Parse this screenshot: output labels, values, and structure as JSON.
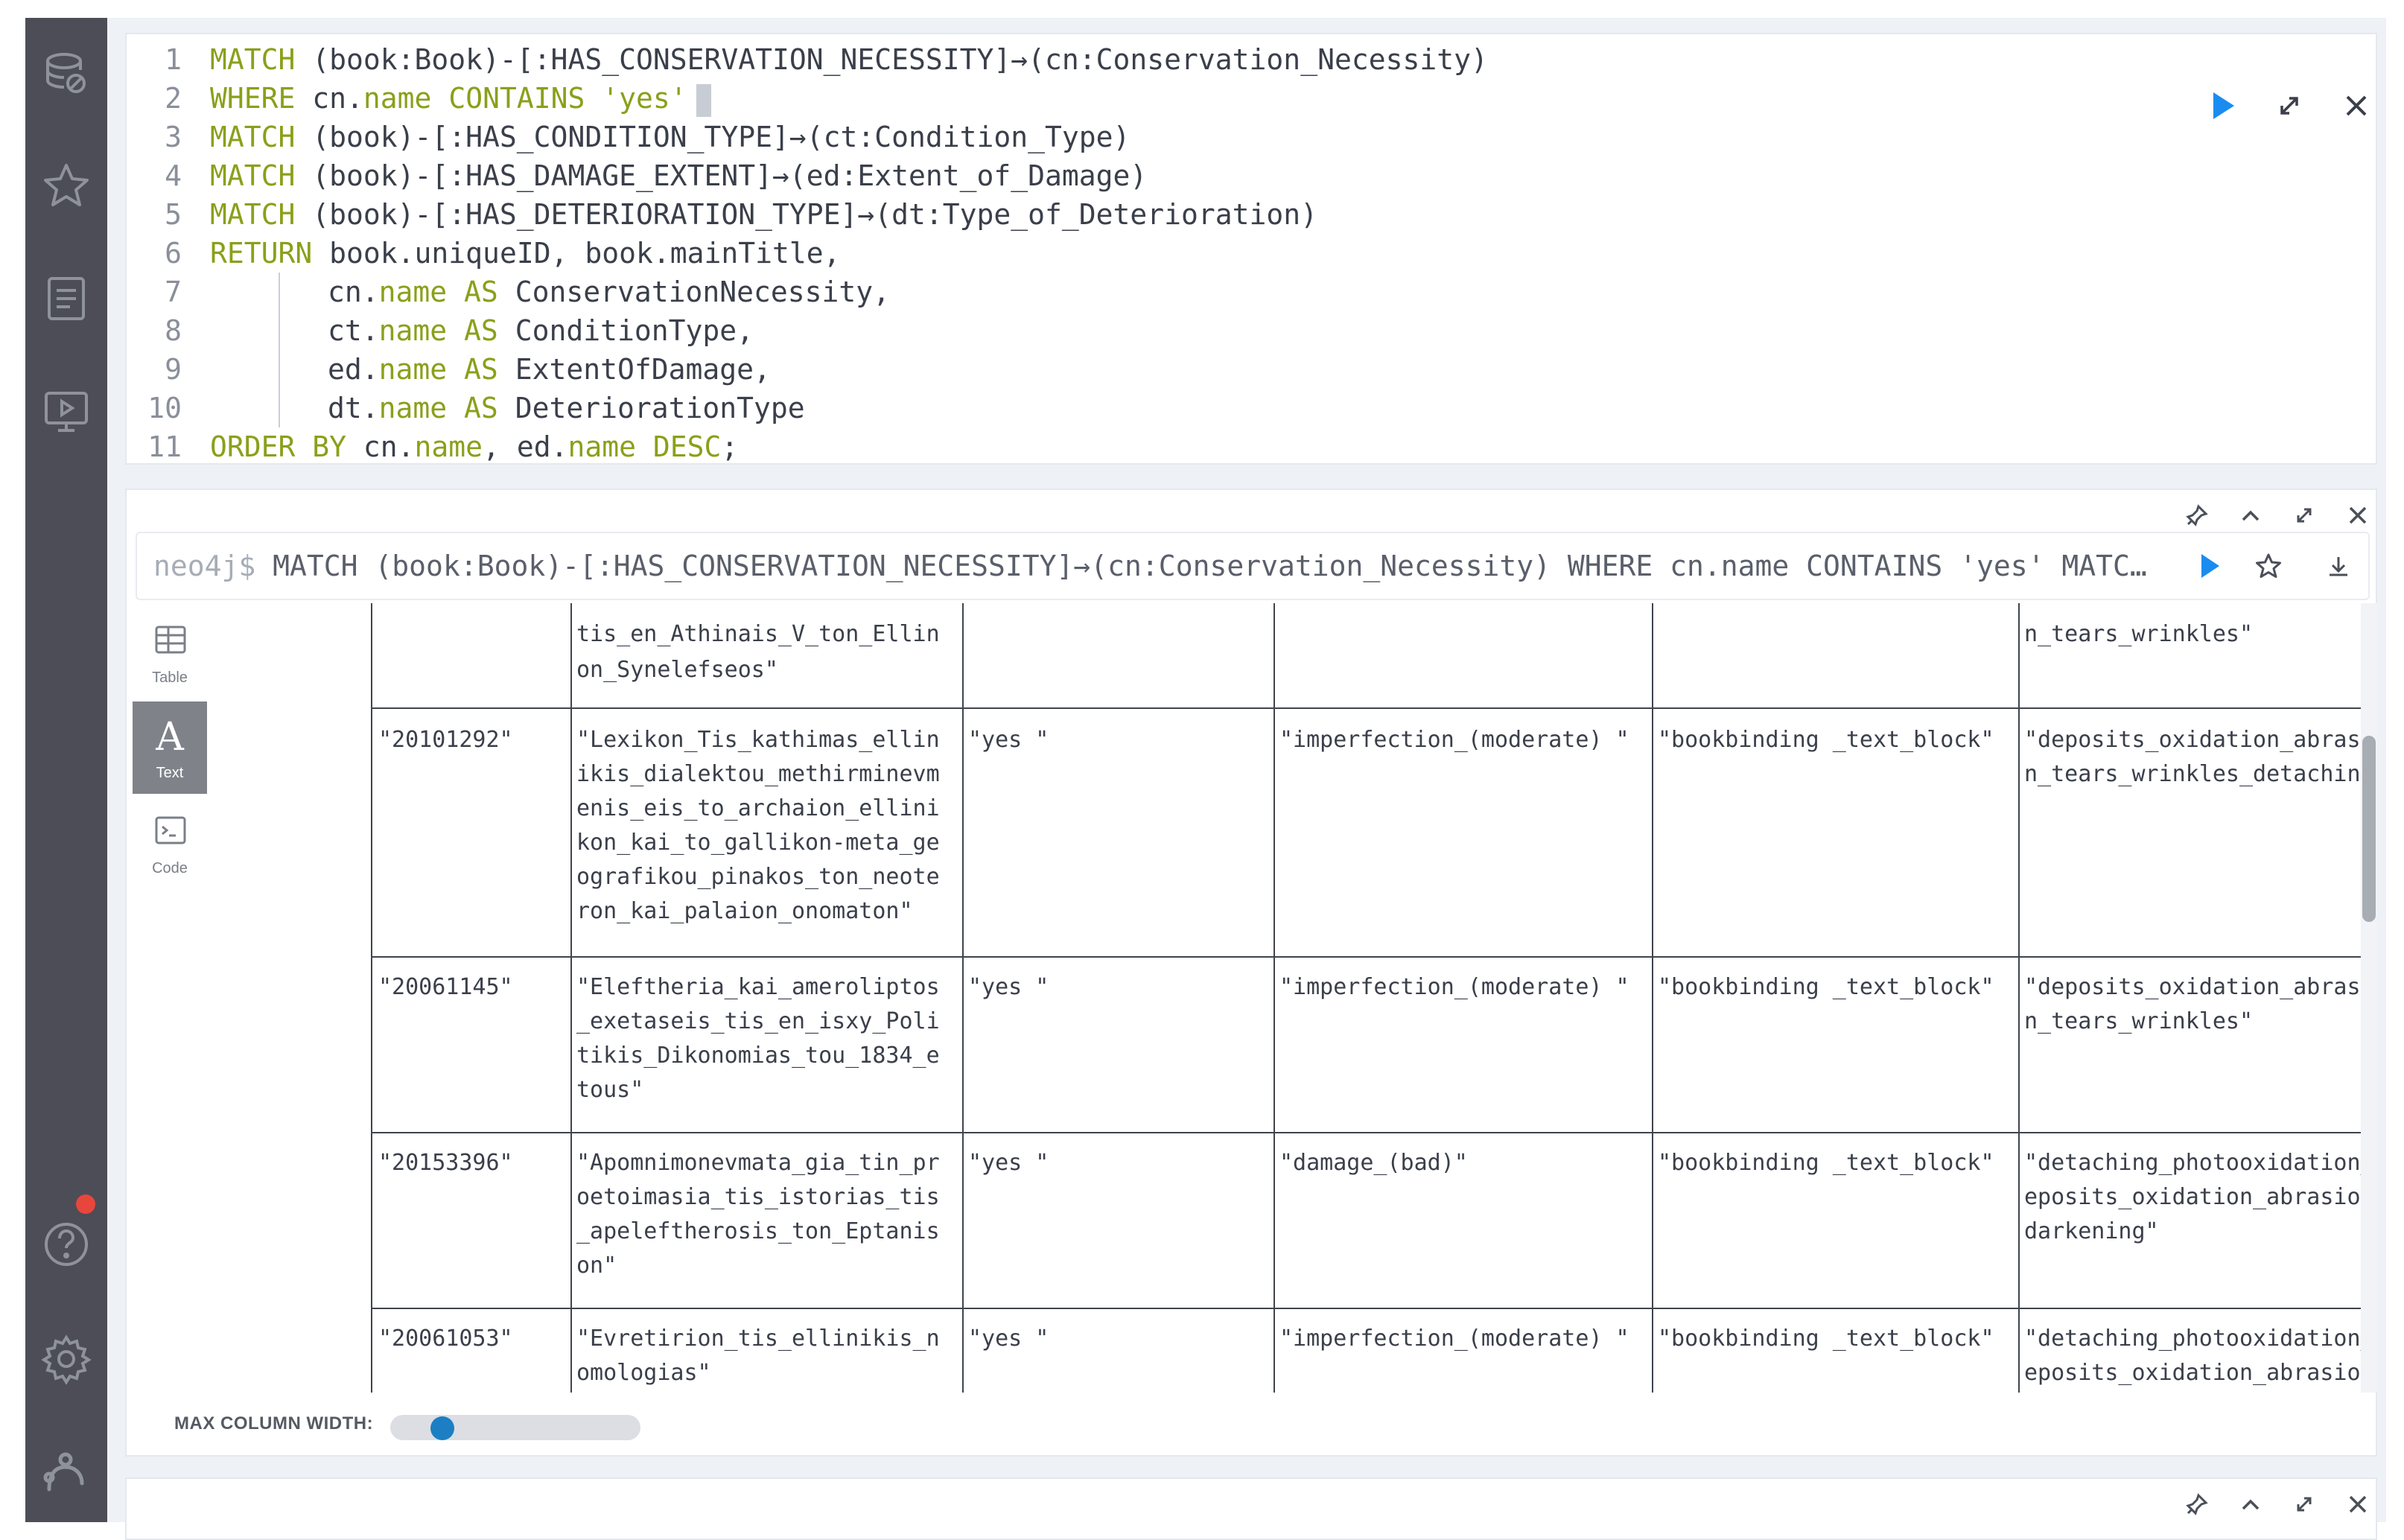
{
  "sidebar": {
    "icons": [
      "database-icon",
      "star-icon",
      "document-icon",
      "play-monitor-icon",
      "help-icon",
      "settings-icon",
      "neo4j-logo-icon"
    ]
  },
  "editor": {
    "lines": [
      {
        "n": "1"
      },
      {
        "n": "2"
      },
      {
        "n": "3"
      },
      {
        "n": "4"
      },
      {
        "n": "5"
      },
      {
        "n": "6"
      },
      {
        "n": "7"
      },
      {
        "n": "8"
      },
      {
        "n": "9"
      },
      {
        "n": "10"
      },
      {
        "n": "11"
      }
    ],
    "code": {
      "l1a": "MATCH",
      "l1b": " (book:Book)-[:HAS_CONSERVATION_NECESSITY]→(cn:Conservation_Necessity)",
      "l2a": "WHERE",
      "l2b": " cn.",
      "l2c": "name",
      "l2d": " ",
      "l2e": "CONTAINS",
      "l2f": " ",
      "l2g": "'yes'",
      "l3a": "MATCH",
      "l3b": " (book)-[:HAS_CONDITION_TYPE]→(ct:Condition_Type)",
      "l4a": "MATCH",
      "l4b": " (book)-[:HAS_DAMAGE_EXTENT]→(ed:Extent_of_Damage)",
      "l5a": "MATCH",
      "l5b": " (book)-[:HAS_DETERIORATION_TYPE]→(dt:Type_of_Deterioration)",
      "l6a": "RETURN",
      "l6b": " book.uniqueID, book.mainTitle,",
      "l7a": "cn.",
      "l7b": "name",
      "l7c": " ",
      "l7d": "AS",
      "l7e": " ConservationNecessity,",
      "l8a": "ct.",
      "l8b": "name",
      "l8c": " ",
      "l8d": "AS",
      "l8e": " ConditionType,",
      "l9a": "ed.",
      "l9b": "name",
      "l9c": " ",
      "l9d": "AS",
      "l9e": " ExtentOfDamage,",
      "l10a": "dt.",
      "l10b": "name",
      "l10c": " ",
      "l10d": "AS",
      "l10e": " DeteriorationType",
      "l11a": "ORDER BY",
      "l11b": " cn.",
      "l11c": "name",
      "l11d": ", ed.",
      "l11e": "name",
      "l11f": " ",
      "l11g": "DESC",
      "l11h": ";"
    }
  },
  "result": {
    "prompt": "neo4j$",
    "query": " MATCH (book:Book)-[:HAS_CONSERVATION_NECESSITY]→(cn:Conservation_Necessity) WHERE cn.name CONTAINS 'yes' MATC…",
    "tabs": {
      "table": "Table",
      "text": "Text",
      "code": "Code"
    },
    "max_column_width_label": "MAX COLUMN WIDTH:",
    "max_column_width_value": 0.16,
    "rows": {
      "r0": {
        "title": [
          "tis_en_Athinais_V_ton_Ellin",
          "on_Synelefseos\""
        ],
        "det": [
          "n_tears_wrinkles\""
        ]
      },
      "r1": {
        "id": "\"20101292\"",
        "title": [
          "\"Lexikon_Tis_kathimas_ellin",
          "ikis_dialektou_methirminevm",
          "enis_eis_to_archaion_ellini",
          "kon_kai_to_gallikon-meta_ge",
          "ografikou_pinakos_ton_neote",
          "ron_kai_palaion_onomaton\""
        ],
        "cn": "\"yes \"",
        "ct": "\"imperfection_(moderate) \"",
        "ed": "\"bookbinding _text_block\"",
        "det": [
          "\"deposits_oxidation_abrasio",
          "n_tears_wrinkles_detaching\""
        ]
      },
      "r2": {
        "id": "\"20061145\"",
        "title": [
          "\"Eleftheria_kai_ameroliptos",
          "_exetaseis_tis_en_isxy_Poli",
          "tikis_Dikonomias_tou_1834_e",
          "tous\""
        ],
        "cn": "\"yes \"",
        "ct": "\"imperfection_(moderate) \"",
        "ed": "\"bookbinding _text_block\"",
        "det": [
          "\"deposits_oxidation_abrasio",
          "n_tears_wrinkles\""
        ]
      },
      "r3": {
        "id": "\"20153396\"",
        "title": [
          "\"Apomnimonevmata_gia_tin_pr",
          "oetoimasia_tis_istorias_tis",
          "_apeleftherosis_ton_Eptanis",
          "on\""
        ],
        "cn": "\"yes \"",
        "ct": "\"damage_(bad)\"",
        "ed": "\"bookbinding _text_block\"",
        "det": [
          "\"detaching_photooxidation_d",
          "eposits_oxidation_abrasion_",
          "darkening\""
        ]
      },
      "r4": {
        "id": "\"20061053\"",
        "title": [
          "\"Evretirion_tis_ellinikis_n",
          "omologias\""
        ],
        "cn": "\"yes \"",
        "ct": "\"imperfection_(moderate) \"",
        "ed": "\"bookbinding _text_block\"",
        "det": [
          "\"detaching_photooxidation_d",
          "eposits_oxidation_abrasion_"
        ]
      }
    }
  },
  "colors": {
    "sidebar_bg": "#4d4d57",
    "keyword": "#8aa01a",
    "run_button": "#1a8cf0",
    "slider_thumb": "#1c7fc4",
    "notification_dot": "#e8463c"
  }
}
